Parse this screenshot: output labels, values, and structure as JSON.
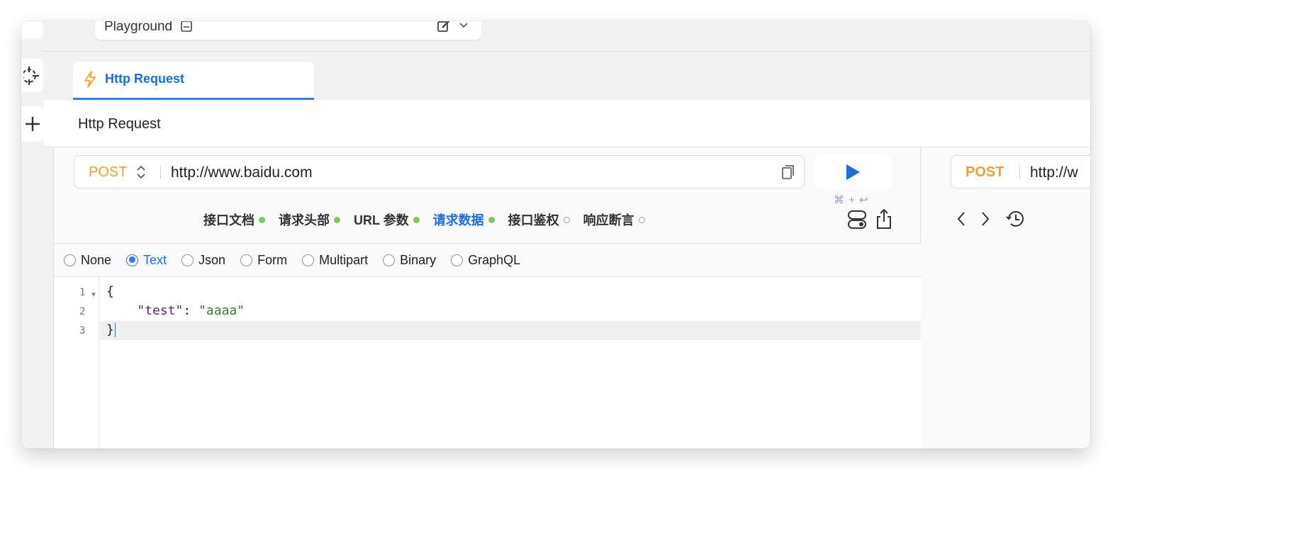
{
  "playground": {
    "label": "Playground"
  },
  "tab": {
    "label": "Http Request"
  },
  "page_title": "Http Request",
  "request": {
    "method": "POST",
    "url": "http://www.baidu.com",
    "shortcut": "⌘ + ↩"
  },
  "subtabs": [
    {
      "label": "接口文档",
      "indicator": "filled"
    },
    {
      "label": "请求头部",
      "indicator": "filled"
    },
    {
      "label": "URL 参数",
      "indicator": "filled"
    },
    {
      "label": "请求数据",
      "indicator": "filled",
      "active": true
    },
    {
      "label": "接口鉴权",
      "indicator": "empty"
    },
    {
      "label": "响应断言",
      "indicator": "empty"
    }
  ],
  "body_types": [
    {
      "label": "None",
      "selected": false
    },
    {
      "label": "Text",
      "selected": true
    },
    {
      "label": "Json",
      "selected": false
    },
    {
      "label": "Form",
      "selected": false
    },
    {
      "label": "Multipart",
      "selected": false
    },
    {
      "label": "Binary",
      "selected": false
    },
    {
      "label": "GraphQL",
      "selected": false
    }
  ],
  "editor": {
    "line_numbers": [
      "1",
      "2",
      "3"
    ],
    "line1": "{",
    "line2_key": "\"test\"",
    "line2_colon": ": ",
    "line2_value": "\"aaaa\"",
    "line3": "}"
  },
  "response_panel": {
    "method": "POST",
    "url": "http://w"
  },
  "colors": {
    "accent": "#2f80ed",
    "method": "#f0a030",
    "active_indicator": "#7cc85f",
    "run_icon": "#1a6fe0"
  },
  "icons": [
    "document-icon",
    "edit-icon",
    "chevron-down-icon",
    "crosshair-icon",
    "plus-icon",
    "bolt-icon",
    "up-down-caret-icon",
    "copy-icon",
    "play-icon",
    "toggle-settings-icon",
    "share-icon",
    "back-icon",
    "forward-icon",
    "history-icon"
  ]
}
